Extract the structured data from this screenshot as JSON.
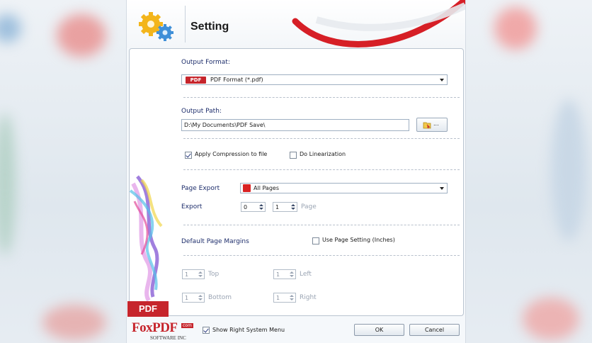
{
  "window": {
    "title": "Setting"
  },
  "output_format": {
    "label": "Output Format:",
    "badge": "PDF",
    "selected": "PDF Format (*.pdf)"
  },
  "output_path": {
    "label": "Output Path:",
    "value": "D:\\My Documents\\PDF Save\\",
    "browse_label": "..."
  },
  "options": {
    "compression_label": "Apply Compression to file",
    "compression_checked": true,
    "linearization_label": "Do Linearization",
    "linearization_checked": false
  },
  "page_export": {
    "label": "Page Export",
    "selected": "All Pages",
    "export_label": "Export",
    "from_value": "0",
    "to_value": "1",
    "page_label": "Page"
  },
  "margins": {
    "label": "Default Page Margins",
    "use_page_setting_label": "Use Page Setting (Inches)",
    "use_page_setting_checked": false,
    "top_value": "1",
    "top_label": "Top",
    "left_value": "1",
    "left_label": "Left",
    "bottom_value": "1",
    "bottom_label": "Bottom",
    "right_value": "1",
    "right_label": "Right"
  },
  "side_art": {
    "badge": "PDF"
  },
  "footer": {
    "show_menu_label": "Show Right System Menu",
    "show_menu_checked": true,
    "ok_label": "OK",
    "cancel_label": "Cancel",
    "logo_text": "FoxPDF",
    "logo_com": "com",
    "logo_sub": "SOFTWARE INC"
  },
  "colors": {
    "accent_red": "#d61f26",
    "label_blue": "#1d2d6b",
    "panel_border": "#b9c4d0"
  }
}
